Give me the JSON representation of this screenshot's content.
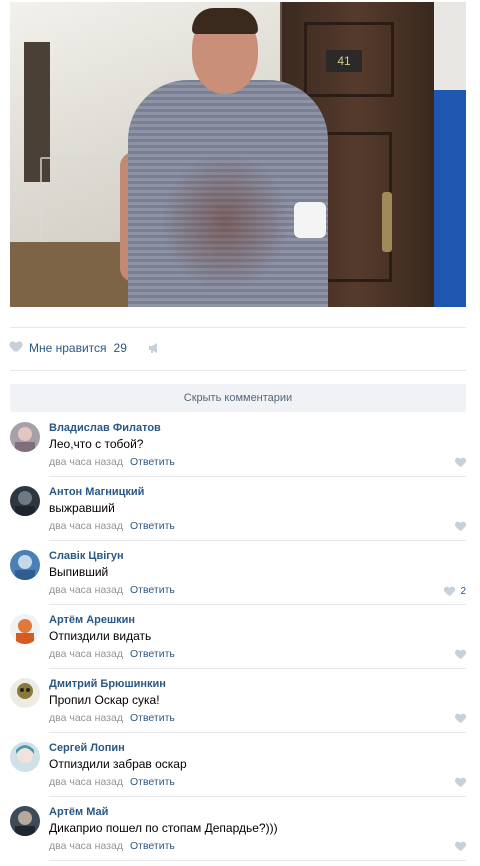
{
  "post": {
    "photo": {
      "description_icon": "photo-image",
      "door_number": "41"
    },
    "likes": {
      "label": "Мне нравится",
      "count": "29"
    },
    "hide_comments_label": "Скрыть комментарии"
  },
  "colors": {
    "link": "#2a5885",
    "meta": "#939393",
    "heart": "#c5d0db",
    "button_bg": "#f0f2f5",
    "divider": "#e7e8ec"
  },
  "comments": [
    {
      "author": "Владислав Филатов",
      "text": "Лео,что с тобой?",
      "time": "два часа назад",
      "reply": "Ответить",
      "likes": ""
    },
    {
      "author": "Антон Магницкий",
      "text": "выжравший",
      "time": "два часа назад",
      "reply": "Ответить",
      "likes": ""
    },
    {
      "author": "Славік Цвігун",
      "text": "Выпивший",
      "time": "два часа назад",
      "reply": "Ответить",
      "likes": "2"
    },
    {
      "author": "Артём Арешкин",
      "text": "Отпиздили видать",
      "time": "два часа назад",
      "reply": "Ответить",
      "likes": ""
    },
    {
      "author": "Дмитрий Брюшинкин",
      "text": "Пропил Оскар сука!",
      "time": "два часа назад",
      "reply": "Ответить",
      "likes": ""
    },
    {
      "author": "Сергей Лопин",
      "text": "Отпиздили забрав оскар",
      "time": "два часа назад",
      "reply": "Ответить",
      "likes": ""
    },
    {
      "author": "Артём Май",
      "text": "Дикаприо пошел по стопам Депардье?)))",
      "time": "два часа назад",
      "reply": "Ответить",
      "likes": ""
    }
  ]
}
